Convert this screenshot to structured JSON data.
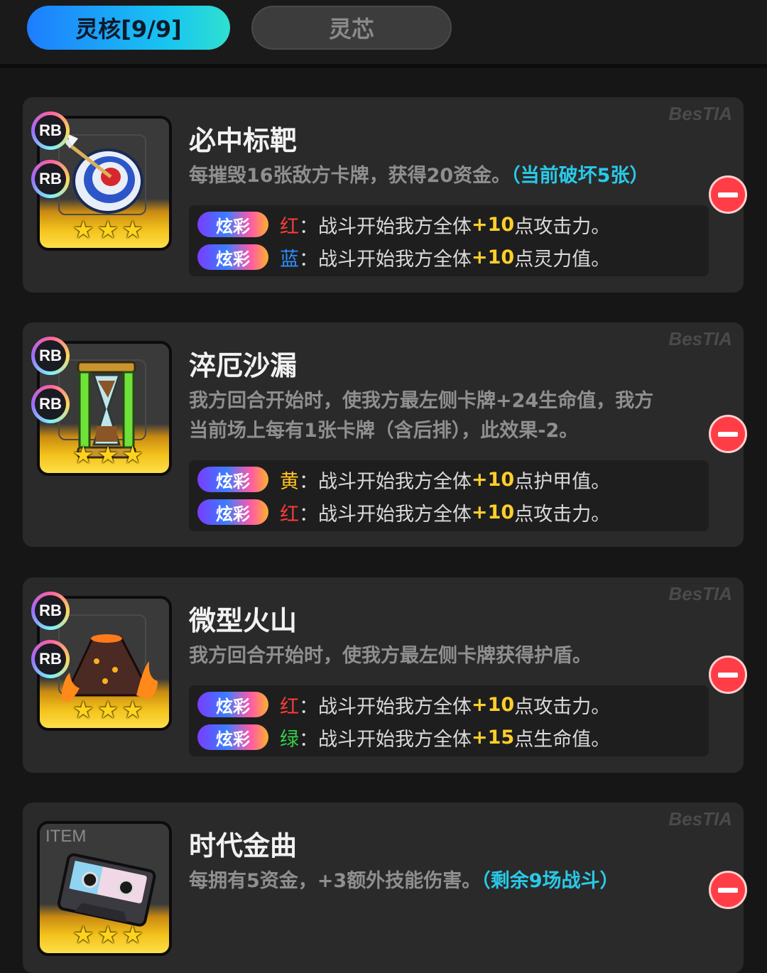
{
  "tabs": [
    {
      "label": "灵核[9/9]",
      "active": true
    },
    {
      "label": "灵芯",
      "active": false
    }
  ],
  "bonus_tag": "炫彩",
  "rb_badge": "RB",
  "item_badge": "ITEM",
  "watermark": "BesTIA",
  "cards": [
    {
      "title": "必中标靶",
      "desc_lines": [
        "每摧毁16张敌方卡牌，获得20资金。"
      ],
      "highlight": "（当前破坏5张）",
      "bonuses": [
        {
          "color": "红",
          "color_hex": "#ff3b3b",
          "pre": "：战斗开始我方全体",
          "num": "+10",
          "post": "点攻击力。"
        },
        {
          "color": "蓝",
          "color_hex": "#2f8dff",
          "pre": "：战斗开始我方全体",
          "num": "+10",
          "post": "点灵力值。"
        }
      ]
    },
    {
      "title": "淬厄沙漏",
      "desc_lines": [
        "我方回合开始时，使我方最左侧卡牌+24生命值，我方",
        "当前场上每有1张卡牌（含后排），此效果-2。"
      ],
      "highlight": "",
      "bonuses": [
        {
          "color": "黄",
          "color_hex": "#ffc21f",
          "pre": "：战斗开始我方全体",
          "num": "+10",
          "post": "点护甲值。"
        },
        {
          "color": "红",
          "color_hex": "#ff3b3b",
          "pre": "：战斗开始我方全体",
          "num": "+10",
          "post": "点攻击力。"
        }
      ]
    },
    {
      "title": "微型火山",
      "desc_lines": [
        "我方回合开始时，使我方最左侧卡牌获得护盾。"
      ],
      "highlight": "",
      "bonuses": [
        {
          "color": "红",
          "color_hex": "#ff3b3b",
          "pre": "：战斗开始我方全体",
          "num": "+10",
          "post": "点攻击力。"
        },
        {
          "color": "绿",
          "color_hex": "#33d04a",
          "pre": "：战斗开始我方全体",
          "num": "+15",
          "post": "点生命值。"
        }
      ]
    },
    {
      "title": "时代金曲",
      "desc_lines": [
        "每拥有5资金，+3额外技能伤害。"
      ],
      "highlight": "（剩余9场战斗）",
      "bonuses": []
    }
  ],
  "icons": [
    "target-arrow-icon",
    "hourglass-icon",
    "volcano-icon",
    "cassette-tape-icon",
    "star-icon",
    "minus-icon"
  ],
  "colors": {
    "accent": "#18c6f0",
    "highlight": "#29c9e8",
    "remove": "#ff3d46",
    "star": "#ffd21c"
  }
}
